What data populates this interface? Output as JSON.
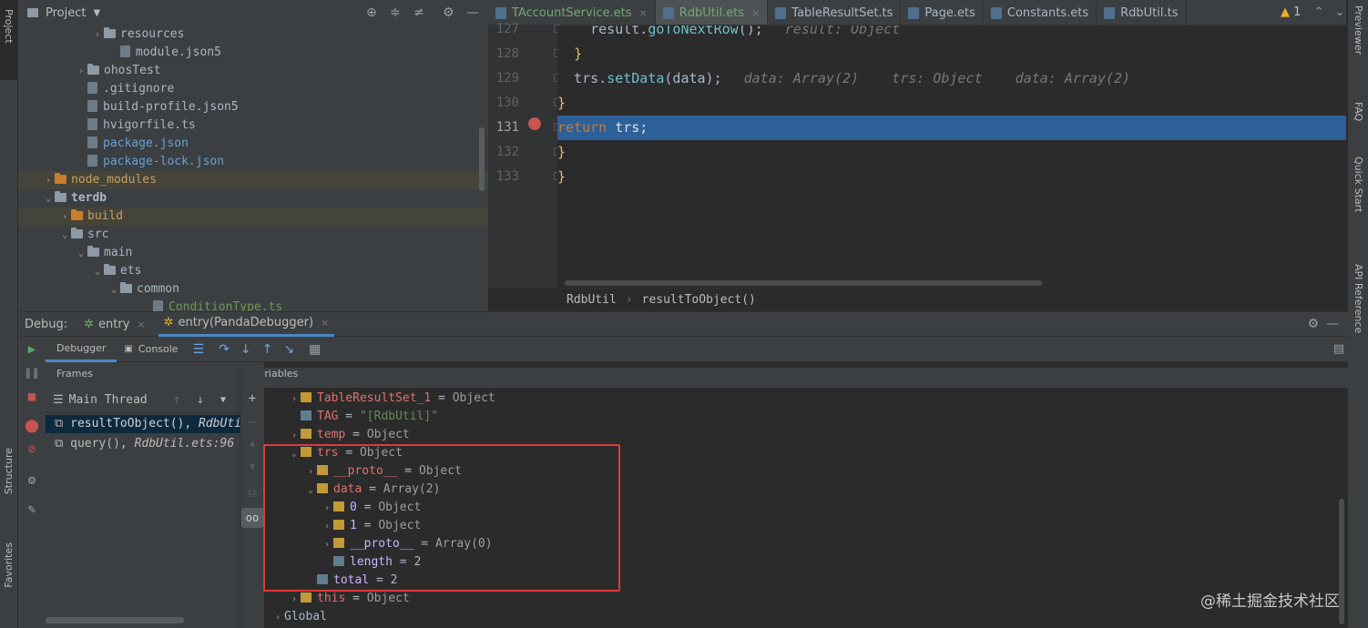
{
  "project": {
    "title": "Project",
    "tree": [
      {
        "label": "resources",
        "kind": "folder",
        "indent": 4,
        "arrow": "›"
      },
      {
        "label": "module.json5",
        "kind": "file",
        "indent": 5,
        "arrow": ""
      },
      {
        "label": "ohosTest",
        "kind": "folder",
        "indent": 3,
        "arrow": "›"
      },
      {
        "label": ".gitignore",
        "kind": "file",
        "indent": 3,
        "arrow": ""
      },
      {
        "label": "build-profile.json5",
        "kind": "file",
        "indent": 3,
        "arrow": ""
      },
      {
        "label": "hvigorfile.ts",
        "kind": "file",
        "indent": 3,
        "arrow": ""
      },
      {
        "label": "package.json",
        "kind": "file-blue",
        "indent": 3,
        "arrow": ""
      },
      {
        "label": "package-lock.json",
        "kind": "file-blue",
        "indent": 3,
        "arrow": ""
      },
      {
        "label": "node_modules",
        "kind": "folder-orange",
        "indent": 1,
        "arrow": "›"
      },
      {
        "label": "terdb",
        "kind": "folder",
        "indent": 1,
        "arrow": "⌄"
      },
      {
        "label": "build",
        "kind": "folder-orange",
        "indent": 2,
        "arrow": "›"
      },
      {
        "label": "src",
        "kind": "folder",
        "indent": 2,
        "arrow": "⌄"
      },
      {
        "label": "main",
        "kind": "folder",
        "indent": 3,
        "arrow": "⌄"
      },
      {
        "label": "ets",
        "kind": "folder",
        "indent": 4,
        "arrow": "⌄"
      },
      {
        "label": "common",
        "kind": "folder",
        "indent": 5,
        "arrow": "⌄"
      },
      {
        "label": "ConditionType.ts",
        "kind": "file-green",
        "indent": 7,
        "arrow": ""
      }
    ]
  },
  "editor": {
    "tabs": [
      {
        "label": "TAccountService.ets",
        "style": "green"
      },
      {
        "label": "RdbUtil.ets",
        "style": "active"
      },
      {
        "label": "TableResultSet.ts",
        "style": "normal"
      },
      {
        "label": "Page.ets",
        "style": "normal"
      },
      {
        "label": "Constants.ets",
        "style": "normal"
      },
      {
        "label": "RdbUtil.ts",
        "style": "normal"
      }
    ],
    "warning_count": "1",
    "lines": [
      {
        "num": "127",
        "code": "    result.goToNextRow();",
        "hint": "result: Object"
      },
      {
        "num": "128",
        "code": "  }",
        "hint": ""
      },
      {
        "num": "129",
        "code": "  trs.setData(data);",
        "hint": "data: Array(2)    trs: Object    data: Array(2)"
      },
      {
        "num": "130",
        "code": "}",
        "hint": ""
      },
      {
        "num": "131",
        "code": "return trs;",
        "hint": ""
      },
      {
        "num": "132",
        "code": "}",
        "hint": ""
      },
      {
        "num": "133",
        "code": "}",
        "hint": ""
      }
    ],
    "breadcrumb": [
      "RdbUtil",
      "resultToObject()"
    ]
  },
  "right_stripe": [
    "Previewer",
    "FAQ",
    "Quick Start",
    "API Reference"
  ],
  "left_stripe": {
    "top": "Project",
    "structure": "Structure",
    "favorites": "Favorites"
  },
  "debug": {
    "label": "Debug:",
    "sessions": [
      "entry",
      "entry(PandaDebugger)"
    ],
    "tabs": [
      "Debugger",
      "Console"
    ],
    "frames_title": "Frames",
    "thread": "Main Thread",
    "frames": [
      {
        "fn": "resultToObject(),",
        "file": "RdbUtil.ets:"
      },
      {
        "fn": "query(),",
        "file": "RdbUtil.ets:96"
      }
    ],
    "variables_title": "Variables",
    "variables": [
      {
        "indent": 0,
        "arrow": "›",
        "name": "TableResultSet_1",
        "value": "Object",
        "kind": "obj"
      },
      {
        "indent": 0,
        "arrow": "",
        "name": "TAG",
        "value": "\"[RdbUtil]\"",
        "kind": "str"
      },
      {
        "indent": 0,
        "arrow": "›",
        "name": "temp",
        "value": "Object",
        "kind": "obj"
      },
      {
        "indent": 0,
        "arrow": "⌄",
        "name": "trs",
        "value": "Object",
        "kind": "obj"
      },
      {
        "indent": 1,
        "arrow": "›",
        "name": "__proto__",
        "value": "Object",
        "kind": "obj"
      },
      {
        "indent": 1,
        "arrow": "⌄",
        "name": "data",
        "value": "Array(2)",
        "kind": "obj"
      },
      {
        "indent": 2,
        "arrow": "›",
        "name": "0",
        "value": "Object",
        "kind": "obj-purple"
      },
      {
        "indent": 2,
        "arrow": "›",
        "name": "1",
        "value": "Object",
        "kind": "obj-purple"
      },
      {
        "indent": 2,
        "arrow": "›",
        "name": "__proto__",
        "value": "Array(0)",
        "kind": "obj-purple"
      },
      {
        "indent": 2,
        "arrow": "",
        "name": "length",
        "value": "2",
        "kind": "prim-purple"
      },
      {
        "indent": 1,
        "arrow": "",
        "name": "total",
        "value": "2",
        "kind": "prim-purple"
      },
      {
        "indent": 0,
        "arrow": "›",
        "name": "this",
        "value": "Object",
        "kind": "obj"
      },
      {
        "indent": -1,
        "arrow": "›",
        "name": "Global",
        "value": "",
        "kind": "scope"
      }
    ]
  },
  "watermark": "@稀土掘金技术社区"
}
